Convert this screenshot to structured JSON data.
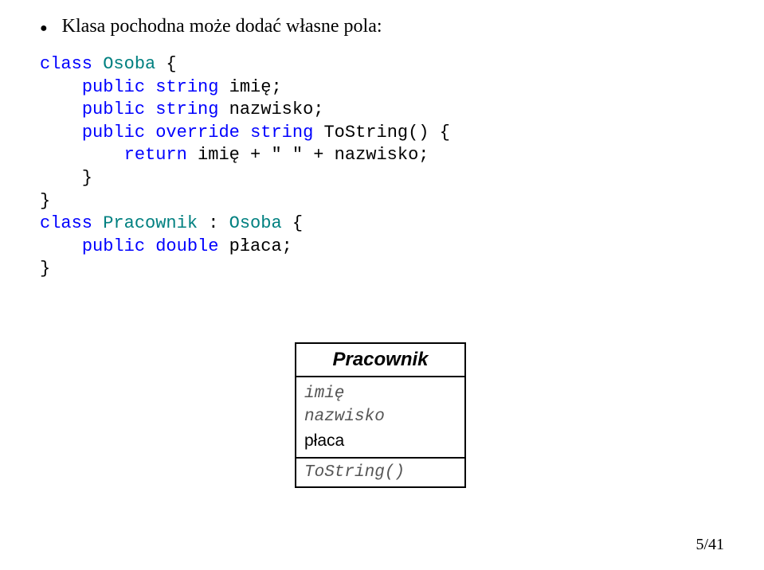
{
  "bullet": {
    "text": "Klasa pochodna może dodać własne pola:"
  },
  "code": {
    "k_class1": "class",
    "cls_osoba": "Osoba",
    "brace_open1": " {",
    "k_public1": "public",
    "k_string1": "string",
    "field_imie": " imię;",
    "k_public2": "public",
    "k_string2": "string",
    "field_nazwisko": " nazwisko;",
    "k_public3": "public",
    "k_override": "override",
    "k_string3": "string",
    "tostring_sig": " ToString() {",
    "k_return": "return",
    "return_expr": " imię + \" \" + nazwisko;",
    "brace_close_inner": "    }",
    "brace_close1": "}",
    "k_class2": "class",
    "cls_pracownik": "Pracownik",
    "colon": " : ",
    "base_osoba": "Osoba",
    "brace_open2": " {",
    "k_public4": "public",
    "k_double": "double",
    "field_placa": " płaca;",
    "brace_close2": "}"
  },
  "uml": {
    "title": "Pracownik",
    "attr_imie": "imię",
    "attr_nazwisko": "nazwisko",
    "attr_placa": "płaca",
    "op_tostring": "ToString()"
  },
  "page_number": "5/41"
}
